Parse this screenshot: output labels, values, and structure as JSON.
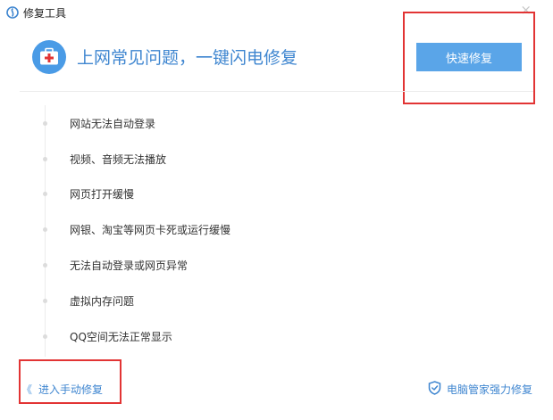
{
  "window": {
    "title": "修复工具",
    "close_glyph": "×"
  },
  "header": {
    "headline": "上网常见问题，一键闪电修复",
    "quick_fix_label": "快速修复"
  },
  "issues": [
    "网站无法自动登录",
    "视频、音频无法播放",
    "网页打开缓慢",
    "网银、淘宝等网页卡死或运行缓慢",
    "无法自动登录或网页异常",
    "虚拟内存问题",
    "QQ空间无法正常显示"
  ],
  "footer": {
    "manual_chevron": "《",
    "manual_fix_label": "进入手动修复",
    "pc_manager_fix_label": "电脑管家强力修复"
  },
  "colors": {
    "accent": "#3f86d0",
    "button": "#5aa5e8",
    "highlight": "#e23434",
    "icon_circle": "#4a9be6"
  }
}
